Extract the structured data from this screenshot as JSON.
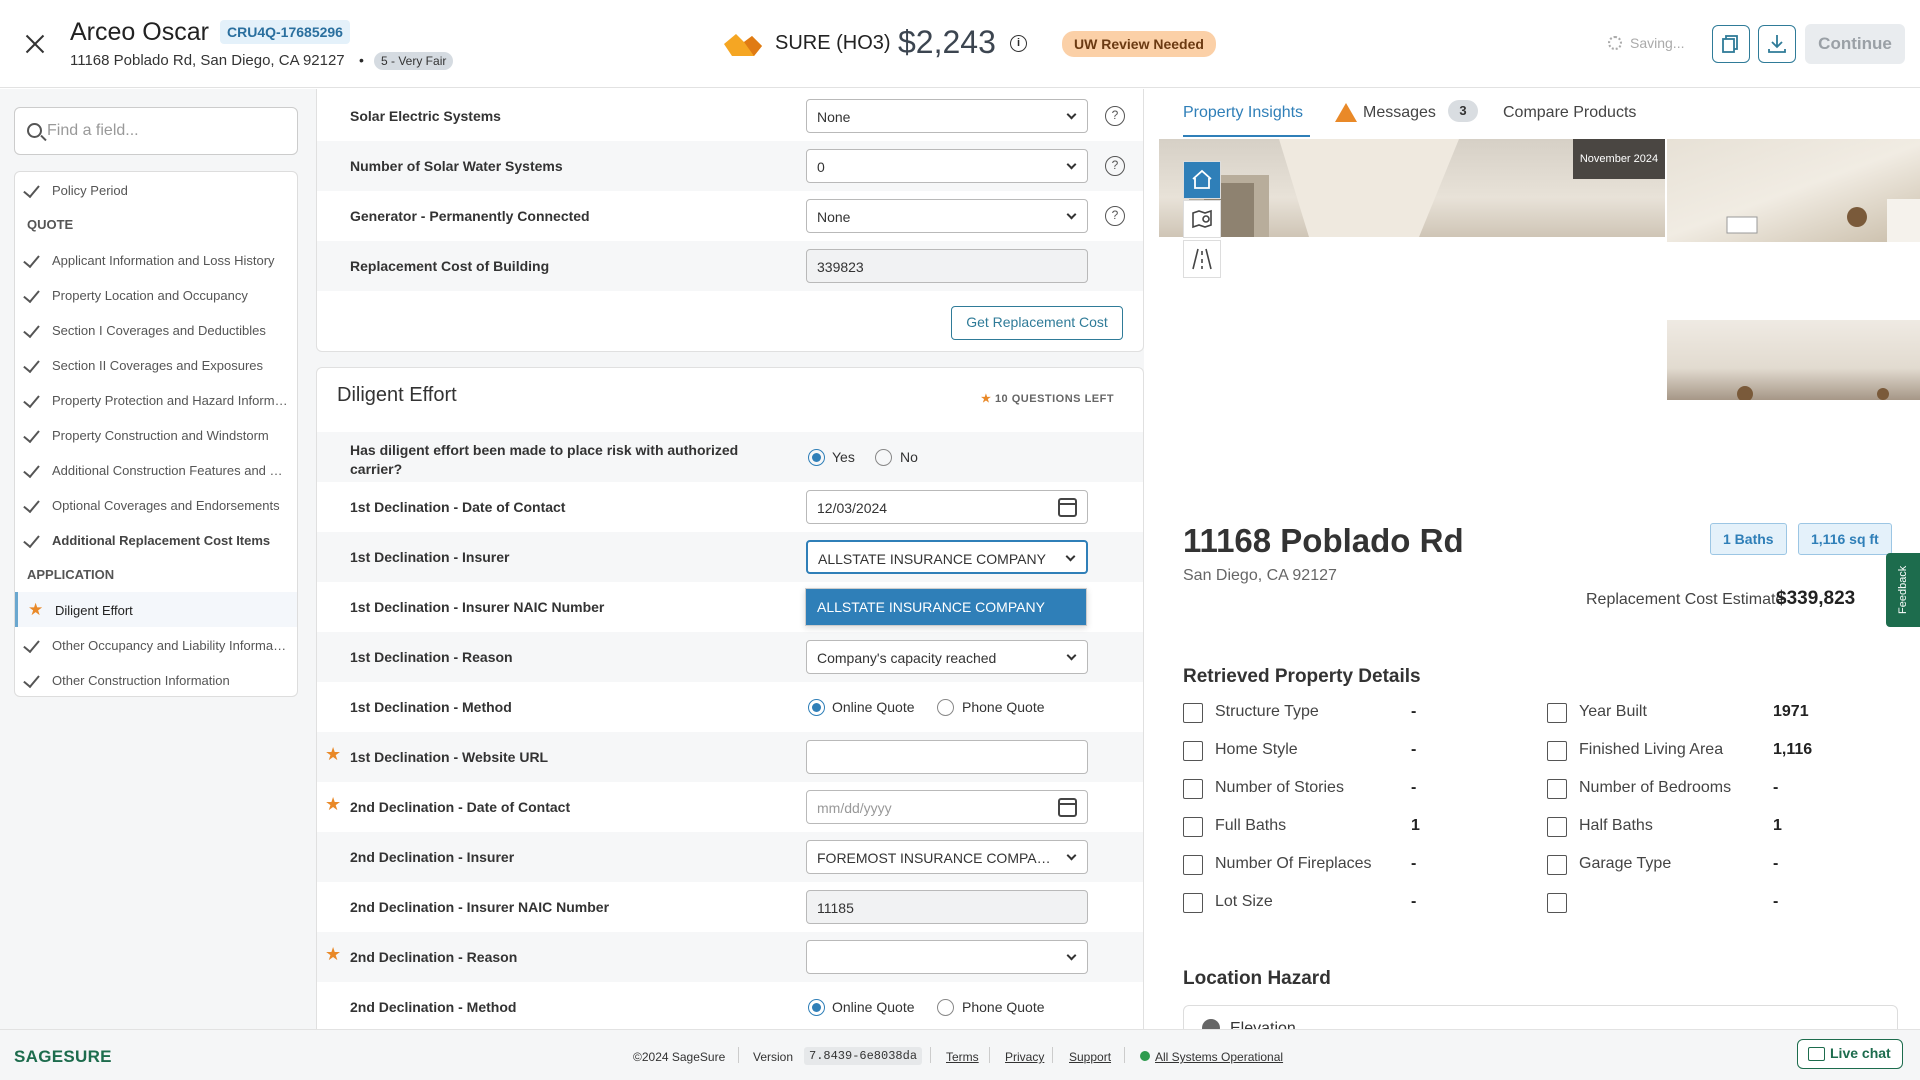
{
  "header": {
    "customer_name": "Arceo Oscar",
    "quote_id": "CRU4Q-17685296",
    "address": "11168 Poblado Rd, San Diego, CA 92127",
    "bullet": "•",
    "score": "5 - Very Fair",
    "product": "SURE (HO3)",
    "price": "$2,243",
    "info": "i",
    "uw_status": "UW Review Needed",
    "saving": "Saving...",
    "continue": "Continue"
  },
  "search": {
    "placeholder": "Find a field..."
  },
  "nav": {
    "policy_period": "Policy Period",
    "quote_heading": "QUOTE",
    "quote_items": [
      "Applicant Information and Loss History",
      "Property Location and Occupancy",
      "Section I Coverages and Deductibles",
      "Section II Coverages and Exposures",
      "Property Protection and Hazard Information",
      "Property Construction and Windstorm",
      "Additional Construction Features and Updates",
      "Optional Coverages and Endorsements",
      "Additional Replacement Cost Items"
    ],
    "application_heading": "APPLICATION",
    "application_items": [
      "Diligent Effort",
      "Other Occupancy and Liability Information",
      "Other Construction Information"
    ]
  },
  "form1": {
    "rows": [
      {
        "label": "Solar Electric Systems",
        "value": "None"
      },
      {
        "label": "Number of Solar Water Systems",
        "value": "0"
      },
      {
        "label": "Generator - Permanently Connected",
        "value": "None"
      },
      {
        "label": "Replacement Cost of Building",
        "value": "339823"
      }
    ],
    "help": "?",
    "replacement_button": "Get Replacement Cost"
  },
  "diligent": {
    "title": "Diligent Effort",
    "questions_left": "10 QUESTIONS LEFT",
    "star": "★",
    "q1_label": "Has diligent effort been made to place risk with authorized carrier?",
    "yes": "Yes",
    "no": "No",
    "d1_date_label": "1st Declination - Date of Contact",
    "d1_date": "12/03/2024",
    "d1_insurer_label": "1st Declination - Insurer",
    "d1_insurer": "ALLSTATE INSURANCE COMPANY",
    "d1_naic_label": "1st Declination - Insurer NAIC Number",
    "d1_reason_label": "1st Declination - Reason",
    "d1_reason": "Company's capacity reached",
    "d1_method_label": "1st Declination - Method",
    "online": "Online Quote",
    "phone": "Phone Quote",
    "d1_url_label": "1st Declination - Website URL",
    "d2_date_label": "2nd Declination - Date of Contact",
    "d2_date_placeholder": "mm/dd/yyyy",
    "d2_insurer_label": "2nd Declination - Insurer",
    "d2_insurer": "FOREMOST INSURANCE COMPANY",
    "d2_naic_label": "2nd Declination - Insurer NAIC Number",
    "d2_naic": "11185",
    "d2_reason_label": "2nd Declination - Reason",
    "d2_method_label": "2nd Declination - Method",
    "dropdown_option": "ALLSTATE INSURANCE COMPANY"
  },
  "right": {
    "tabs": [
      "Property Insights",
      "Messages",
      "Compare Products"
    ],
    "messages_count": "3",
    "photo_date": "November 2024",
    "address": "11168 Poblado Rd",
    "city": "San Diego, CA 92127",
    "baths_badge": "1 Baths",
    "sqft_badge": "1,116 sq ft",
    "rce_label": "Replacement Cost Estimate",
    "rce_value": "$339,823",
    "feedback": "Feedback",
    "details_title": "Retrieved Property Details",
    "details_left": [
      {
        "label": "Structure Type",
        "value": "-"
      },
      {
        "label": "Home Style",
        "value": "-"
      },
      {
        "label": "Number of Stories",
        "value": "-"
      },
      {
        "label": "Full Baths",
        "value": "1"
      },
      {
        "label": "Number Of Fireplaces",
        "value": "-"
      },
      {
        "label": "Lot Size",
        "value": "-"
      }
    ],
    "details_right": [
      {
        "label": "Year Built",
        "value": "1971"
      },
      {
        "label": "Finished Living Area",
        "value": "1,116"
      },
      {
        "label": "Number of Bedrooms",
        "value": "-"
      },
      {
        "label": "Half Baths",
        "value": "1"
      },
      {
        "label": "Garage Type",
        "value": "-"
      },
      {
        "label": "",
        "value": "-"
      }
    ],
    "hazard_title": "Location Hazard",
    "hazard_item": "Elevation"
  },
  "footer": {
    "brand": "SAGESURE",
    "copyright": "©2024 SageSure",
    "version_label": "Version",
    "version": "7.8439-6e8038da",
    "terms": "Terms",
    "privacy": "Privacy",
    "support": "Support",
    "status": "All Systems Operational",
    "live_chat": "Live chat"
  }
}
